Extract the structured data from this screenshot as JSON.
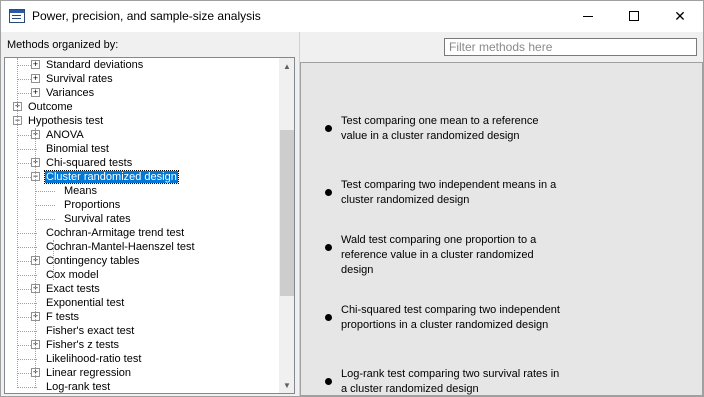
{
  "window": {
    "title": "Power, precision, and sample-size analysis",
    "minimize_icon": "minimize-icon",
    "maximize_icon": "maximize-icon",
    "close_label": "✕"
  },
  "left": {
    "label": "Methods organized by:",
    "tree": [
      {
        "label": "Standard deviations",
        "level": 1,
        "expander": "+"
      },
      {
        "label": "Survival rates",
        "level": 1,
        "expander": "+"
      },
      {
        "label": "Variances",
        "level": 1,
        "expander": "+"
      },
      {
        "label": "Outcome",
        "level": 0,
        "expander": "+"
      },
      {
        "label": "Hypothesis test",
        "level": 0,
        "expander": "-"
      },
      {
        "label": "ANOVA",
        "level": 1,
        "expander": "+"
      },
      {
        "label": "Binomial test",
        "level": 1,
        "expander": ""
      },
      {
        "label": "Chi-squared tests",
        "level": 1,
        "expander": "+"
      },
      {
        "label": "Cluster randomized design",
        "level": 1,
        "expander": "-",
        "selected": true
      },
      {
        "label": "Means",
        "level": 2,
        "expander": ""
      },
      {
        "label": "Proportions",
        "level": 2,
        "expander": ""
      },
      {
        "label": "Survival rates",
        "level": 2,
        "expander": ""
      },
      {
        "label": "Cochran-Armitage trend test",
        "level": 1,
        "expander": ""
      },
      {
        "label": "Cochran-Mantel-Haenszel test",
        "level": 1,
        "expander": ""
      },
      {
        "label": "Contingency tables",
        "level": 1,
        "expander": "+"
      },
      {
        "label": "Cox model",
        "level": 1,
        "expander": ""
      },
      {
        "label": "Exact tests",
        "level": 1,
        "expander": "+"
      },
      {
        "label": "Exponential test",
        "level": 1,
        "expander": ""
      },
      {
        "label": "F tests",
        "level": 1,
        "expander": "+"
      },
      {
        "label": "Fisher's exact test",
        "level": 1,
        "expander": ""
      },
      {
        "label": "Fisher's z tests",
        "level": 1,
        "expander": "+"
      },
      {
        "label": "Likelihood-ratio test",
        "level": 1,
        "expander": ""
      },
      {
        "label": "Linear regression",
        "level": 1,
        "expander": "+"
      },
      {
        "label": "Log-rank test",
        "level": 1,
        "expander": ""
      }
    ]
  },
  "right": {
    "filter_placeholder": "Filter methods here",
    "methods": [
      {
        "line1": "Test comparing one mean to a reference",
        "line2": "value in a cluster randomized design",
        "line3": ""
      },
      {
        "line1": "Test comparing two independent means in a",
        "line2": "cluster randomized design",
        "line3": ""
      },
      {
        "line1": "Wald test comparing one proportion to a",
        "line2": "reference value in a cluster randomized",
        "line3": "design"
      },
      {
        "line1": "Chi-squared test comparing two independent",
        "line2": "proportions in a cluster randomized design",
        "line3": ""
      },
      {
        "line1": "Log-rank test comparing two survival rates in",
        "line2": "a cluster randomized design",
        "line3": ""
      }
    ]
  }
}
